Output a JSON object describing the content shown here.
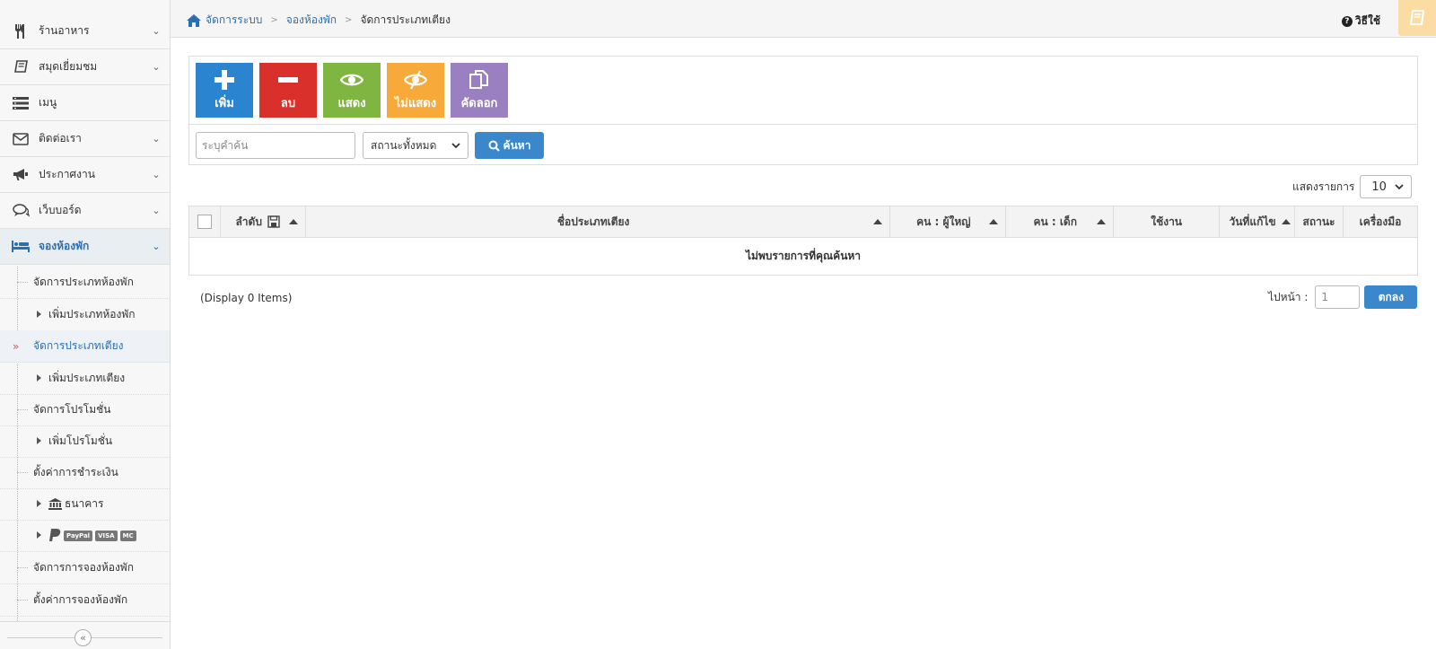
{
  "sidebar": {
    "items": [
      {
        "label": "ร้านอาหาร",
        "icon": "utensils-icon"
      },
      {
        "label": "สมุดเยี่ยมชม",
        "icon": "book-icon"
      },
      {
        "label": "เมนู",
        "icon": "menu-list-icon"
      },
      {
        "label": "ติดต่อเรา",
        "icon": "envelope-icon"
      },
      {
        "label": "ประกาศงาน",
        "icon": "megaphone-icon"
      },
      {
        "label": "เว็บบอร์ด",
        "icon": "comments-icon"
      },
      {
        "label": "จองห้องพัก",
        "icon": "bed-icon"
      }
    ],
    "sub_items": [
      {
        "label": "จัดการประเภทห้องพัก"
      },
      {
        "label": "เพิ่มประเภทห้องพัก"
      },
      {
        "label": "จัดการประเภทเตียง"
      },
      {
        "label": "เพิ่มประเภทเตียง"
      },
      {
        "label": "จัดการโปรโมชั่น"
      },
      {
        "label": "เพิ่มโปรโมชั่น"
      },
      {
        "label": "ตั้งค่าการชำระเงิน"
      },
      {
        "label": "ธนาคาร"
      },
      {
        "label": "PayPal",
        "badges": [
          "PayPal",
          "VISA",
          "MC"
        ]
      },
      {
        "label": "จัดการการจองห้องพัก"
      },
      {
        "label": "ตั้งค่าการจองห้องพัก"
      }
    ],
    "collapse_glyph": "«"
  },
  "header": {
    "breadcrumb": [
      "จัดการระบบ",
      "จองห้องพัก",
      "จัดการประเภทเตียง"
    ],
    "help_label": "วิธีใช้"
  },
  "toolbar": {
    "buttons": [
      {
        "label": "เพิ่ม",
        "icon": "plus-icon"
      },
      {
        "label": "ลบ",
        "icon": "minus-icon"
      },
      {
        "label": "แสดง",
        "icon": "eye-icon"
      },
      {
        "label": "ไม่แสดง",
        "icon": "eye-slash-icon"
      },
      {
        "label": "คัดลอก",
        "icon": "copy-icon"
      }
    ],
    "search_placeholder": "ระบุคำค้น",
    "status_selected": "สถานะทั้งหมด",
    "search_button": "ค้นหา"
  },
  "list": {
    "perpage_label": "แสดงรายการ",
    "perpage_value": "10",
    "columns": [
      "ลำดับ",
      "ชื่อประเภทเตียง",
      "คน : ผู้ใหญ่",
      "คน : เด็ก",
      "ใช้งาน",
      "วันที่แก้ไข",
      "สถานะ",
      "เครื่องมือ"
    ],
    "empty_message": "ไม่พบรายการที่คุณค้นหา",
    "display_info": "(Display 0 Items)",
    "goto_label": "ไปหน้า :",
    "goto_value": "1",
    "go_button": "ตกลง"
  },
  "colors": {
    "accent": "#2a6fb3",
    "add": "#2b84cf",
    "delete": "#d9302b",
    "show": "#7fb541",
    "hide": "#f7aa3a",
    "copy": "#9a7fc1"
  }
}
